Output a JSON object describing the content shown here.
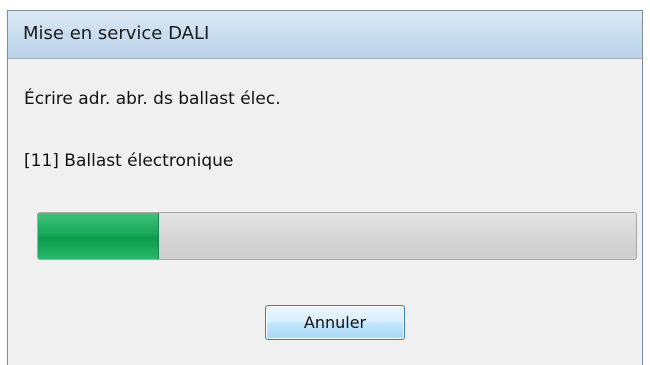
{
  "dialog": {
    "title": "Mise en service DALI",
    "status_text": "Écrire adr. abr. ds ballast élec.",
    "device_text": "[11] Ballast électronique",
    "progress_fraction": 0.2,
    "cancel_label": "Annuler"
  },
  "colors": {
    "progress_fill": "#19a85a",
    "titlebar": "#c8dcef",
    "dialog_background": "#f0f0f0"
  }
}
